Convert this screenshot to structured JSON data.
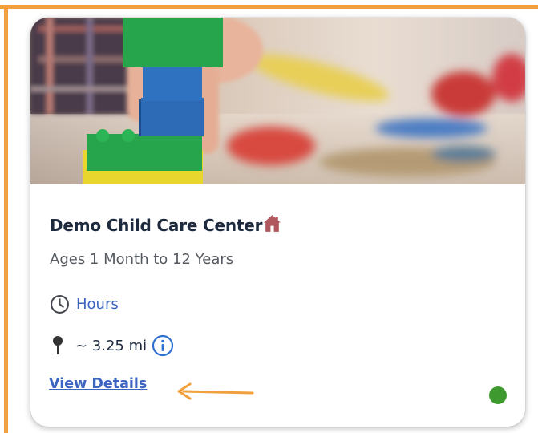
{
  "card": {
    "image_alt": "child stacking building blocks",
    "title": "Demo Child Care Center",
    "ages": "Ages 1 Month to 12 Years",
    "hours_link": "Hours",
    "distance": "~ 3.25 mi",
    "details_link": "View Details",
    "status_color": "#3e9a2f"
  },
  "icons": {
    "home": "home-icon",
    "clock": "clock-icon",
    "pin": "location-pin-icon",
    "info": "info-icon"
  },
  "annotation": {
    "frame_color": "#f0a03c",
    "arrow_color": "#f0a03c"
  },
  "colors": {
    "link": "#3c64c0",
    "title": "#1e2a3d",
    "home_icon": "#b1575e"
  }
}
